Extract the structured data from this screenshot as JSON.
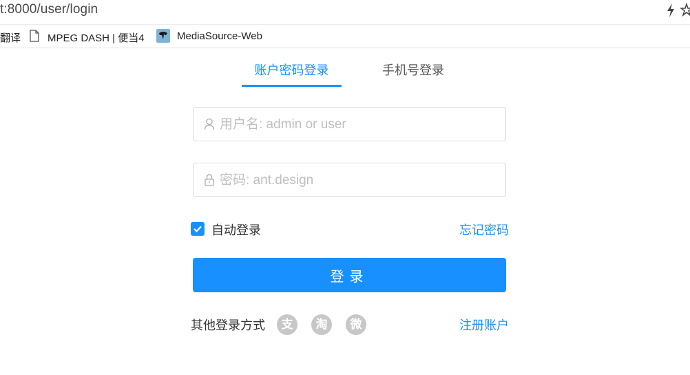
{
  "browser": {
    "url": "t:8000/user/login",
    "bookmarks": [
      {
        "label": "翻译"
      },
      {
        "label": "MPEG DASH | 便当4"
      },
      {
        "label": "MediaSource-Web"
      }
    ]
  },
  "login": {
    "tabs": [
      {
        "label": "账户密码登录",
        "active": true
      },
      {
        "label": "手机号登录",
        "active": false
      }
    ],
    "username": {
      "placeholder": "用户名: admin or user",
      "value": ""
    },
    "password": {
      "placeholder": "密码: ant.design",
      "value": ""
    },
    "remember": {
      "label": "自动登录",
      "checked": true
    },
    "forgot_label": "忘记密码",
    "submit_label": "登录",
    "other_label": "其他登录方式",
    "social": [
      {
        "icon": "alipay-icon",
        "glyph": "支"
      },
      {
        "icon": "taobao-icon",
        "glyph": "淘"
      },
      {
        "icon": "weibo-icon",
        "glyph": "微"
      }
    ],
    "register_label": "注册账户"
  },
  "colors": {
    "primary": "#1890ff",
    "social_gray": "#c7c7c7",
    "border": "#d9d9d9"
  }
}
